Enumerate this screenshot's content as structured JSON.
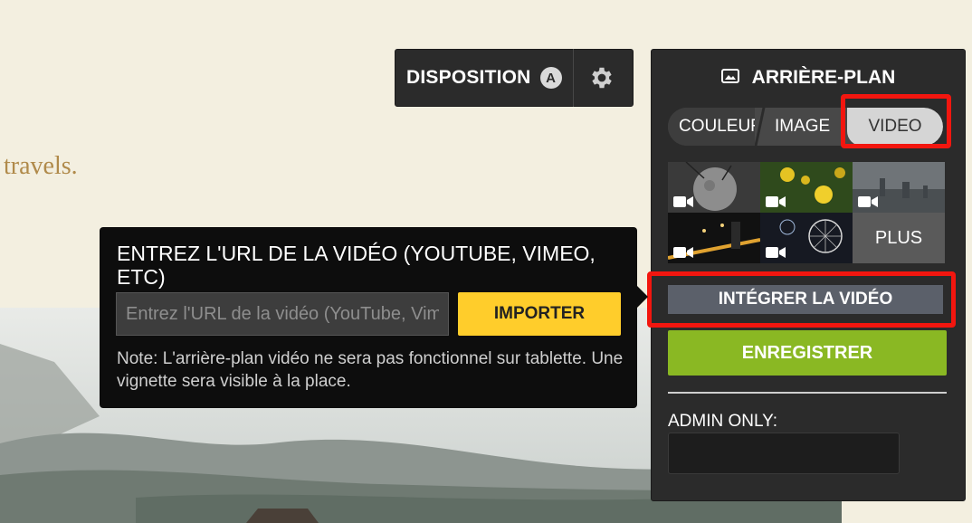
{
  "page": {
    "hero_text": "travels."
  },
  "layout_toolbar": {
    "label": "DISPOSITION",
    "badge": "A",
    "settings_icon": "gear-icon"
  },
  "background_panel": {
    "title": "ARRIÈRE-PLAN",
    "title_icon": "image-icon",
    "tabs": [
      {
        "label": "COULEUR",
        "state": "inactive"
      },
      {
        "label": "IMAGE",
        "state": "inactive"
      },
      {
        "label": "VIDEO",
        "state": "active"
      }
    ],
    "thumbnails": [
      {
        "subject": "moon",
        "icon": "video-camera-icon"
      },
      {
        "subject": "yellow-flowers",
        "icon": "video-camera-icon"
      },
      {
        "subject": "city-skyline",
        "icon": "video-camera-icon"
      },
      {
        "subject": "city-night",
        "icon": "video-camera-icon"
      },
      {
        "subject": "ferris-wheel-fireworks",
        "icon": "video-camera-icon"
      }
    ],
    "more_label": "PLUS",
    "embed_button": "INTÉGRER LA VIDÉO",
    "save_button": "ENREGISTRER",
    "admin_label": "ADMIN ONLY:",
    "admin_value": ""
  },
  "video_popover": {
    "title": "ENTREZ L'URL DE LA VIDÉO (YOUTUBE, VIMEO, ETC)",
    "input_placeholder": "Entrez l'URL de la vidéo (YouTube, Vimeo, etc)",
    "import_button": "IMPORTER",
    "note": "Note: L'arrière-plan vidéo ne sera pas fonctionnel sur tablette. Une vignette sera visible à la place."
  },
  "colors": {
    "highlight": "#f2160f",
    "save_green": "#8ab823",
    "import_yellow": "#ffcd2b",
    "panel_dark": "#2b2b2b",
    "accent_text": "#b08a4a"
  }
}
